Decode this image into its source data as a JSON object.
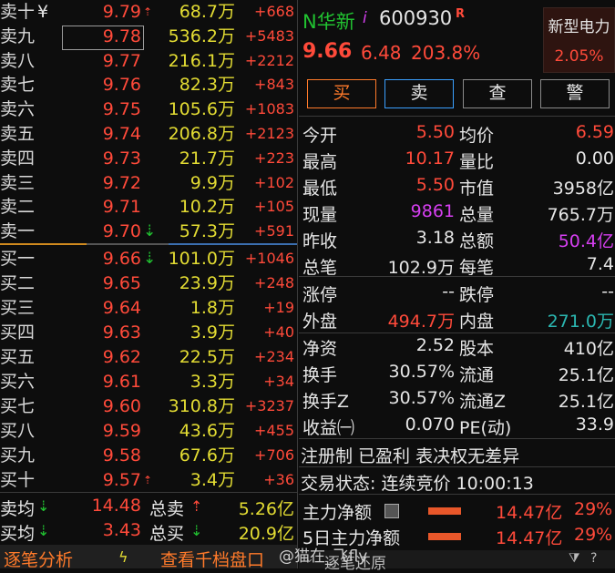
{
  "asks": [
    {
      "label": "卖十",
      "sym": "¥",
      "price": "9.79",
      "arrow": "up",
      "vol": "68.7万",
      "chg": "+668"
    },
    {
      "label": "卖九",
      "price": "9.78",
      "vol": "536.2万",
      "chg": "+5483"
    },
    {
      "label": "卖八",
      "price": "9.77",
      "vol": "216.1万",
      "chg": "+2212"
    },
    {
      "label": "卖七",
      "price": "9.76",
      "vol": "82.3万",
      "chg": "+843"
    },
    {
      "label": "卖六",
      "price": "9.75",
      "vol": "105.6万",
      "chg": "+1083"
    },
    {
      "label": "卖五",
      "price": "9.74",
      "vol": "206.8万",
      "chg": "+2123"
    },
    {
      "label": "卖四",
      "price": "9.73",
      "vol": "21.7万",
      "chg": "+223"
    },
    {
      "label": "卖三",
      "price": "9.72",
      "vol": "9.9万",
      "chg": "+102"
    },
    {
      "label": "卖二",
      "price": "9.71",
      "vol": "10.2万",
      "chg": "+105"
    },
    {
      "label": "卖一",
      "price": "9.70",
      "arrow": "down",
      "vol": "57.3万",
      "chg": "+591"
    }
  ],
  "bids": [
    {
      "label": "买一",
      "price": "9.66",
      "arrow": "down",
      "vol": "101.0万",
      "chg": "+1046"
    },
    {
      "label": "买二",
      "price": "9.65",
      "vol": "23.9万",
      "chg": "+248"
    },
    {
      "label": "买三",
      "price": "9.64",
      "vol": "1.8万",
      "chg": "+19"
    },
    {
      "label": "买四",
      "price": "9.63",
      "vol": "3.9万",
      "chg": "+40"
    },
    {
      "label": "买五",
      "price": "9.62",
      "vol": "22.5万",
      "chg": "+234"
    },
    {
      "label": "买六",
      "price": "9.61",
      "vol": "3.3万",
      "chg": "+34"
    },
    {
      "label": "买七",
      "price": "9.60",
      "vol": "310.8万",
      "chg": "+3237"
    },
    {
      "label": "买八",
      "price": "9.59",
      "vol": "43.6万",
      "chg": "+455"
    },
    {
      "label": "买九",
      "price": "9.58",
      "vol": "67.6万",
      "chg": "+706"
    },
    {
      "label": "买十",
      "price": "9.57",
      "arrow": "up",
      "vol": "3.4万",
      "chg": "+36"
    }
  ],
  "summary": {
    "sell_avg_label": "卖均",
    "sell_avg": "14.48",
    "sell_total_label": "总卖",
    "sell_total": "5.26亿",
    "buy_avg_label": "买均",
    "buy_avg": "3.43",
    "buy_total_label": "总买",
    "buy_total": "20.9亿"
  },
  "footer_left": {
    "tick_label": "逐笔分析",
    "depth_label": "查看千档盘口"
  },
  "header": {
    "name": "N华新",
    "name_badge": "i",
    "code": "600930",
    "r_badge": "R",
    "price": "9.66",
    "change": "6.48",
    "change_pct": "203.8%",
    "sector_name": "新型电力",
    "sector_pct": "2.05%"
  },
  "buttons": {
    "buy": "买",
    "sell": "卖",
    "query": "查",
    "alert": "警"
  },
  "stats1": [
    {
      "l1": "今开",
      "v1": "5.50",
      "c1": "up",
      "l2": "均价",
      "v2": "6.59",
      "c2": "up"
    },
    {
      "l1": "最高",
      "v1": "10.17",
      "c1": "up",
      "l2": "量比",
      "v2": "0.00",
      "c2": "white"
    },
    {
      "l1": "最低",
      "v1": "5.50",
      "c1": "up",
      "l2": "市值",
      "v2": "3958亿",
      "c2": "white"
    },
    {
      "l1": "现量",
      "v1": "9861",
      "c1": "magenta",
      "l2": "总量",
      "v2": "765.7万",
      "c2": "white"
    },
    {
      "l1": "昨收",
      "v1": "3.18",
      "c1": "white",
      "l2": "总额",
      "v2": "50.4亿",
      "c2": "magenta"
    },
    {
      "l1": "总笔",
      "v1": "102.9万",
      "c1": "white",
      "l2": "每笔",
      "v2": "7.4",
      "c2": "white"
    }
  ],
  "stats2": [
    {
      "l1": "涨停",
      "v1": "--",
      "c1": "white",
      "l2": "跌停",
      "v2": "--",
      "c2": "white"
    },
    {
      "l1": "外盘",
      "v1": "494.7万",
      "c1": "up",
      "l2": "内盘",
      "v2": "271.0万",
      "c2": "cyan"
    }
  ],
  "stats3": [
    {
      "l1": "净资",
      "v1": "2.52",
      "c1": "white",
      "l2": "股本",
      "v2": "410亿",
      "c2": "white"
    },
    {
      "l1": "换手",
      "v1": "30.57%",
      "c1": "white",
      "l2": "流通",
      "v2": "25.1亿",
      "c2": "white"
    },
    {
      "l1": "换手Z",
      "v1": "30.57%",
      "c1": "white",
      "l2": "流通Z",
      "v2": "25.1亿",
      "c2": "white"
    },
    {
      "l1": "收益㈠",
      "v1": "0.070",
      "c1": "white",
      "l2": "PE(动)",
      "v2": "33.9",
      "c2": "white"
    }
  ],
  "info": {
    "line1": "注册制 已盈利 表决权无差异",
    "line2": "交易状态: 连续竞价 10:00:13"
  },
  "capital": [
    {
      "label": "主力净额",
      "value": "14.47亿",
      "pct": "29%"
    },
    {
      "label": "5日主力净额",
      "value": "14.47亿",
      "pct": "29%"
    }
  ],
  "watermark": "@猫在_飞fly",
  "footer_right": {
    "label": "逐笔还原"
  },
  "colors": {
    "up": "#ff4a3a",
    "down": "#21c231",
    "volume": "#e3dc33",
    "accent_bar": "#e8572a"
  }
}
